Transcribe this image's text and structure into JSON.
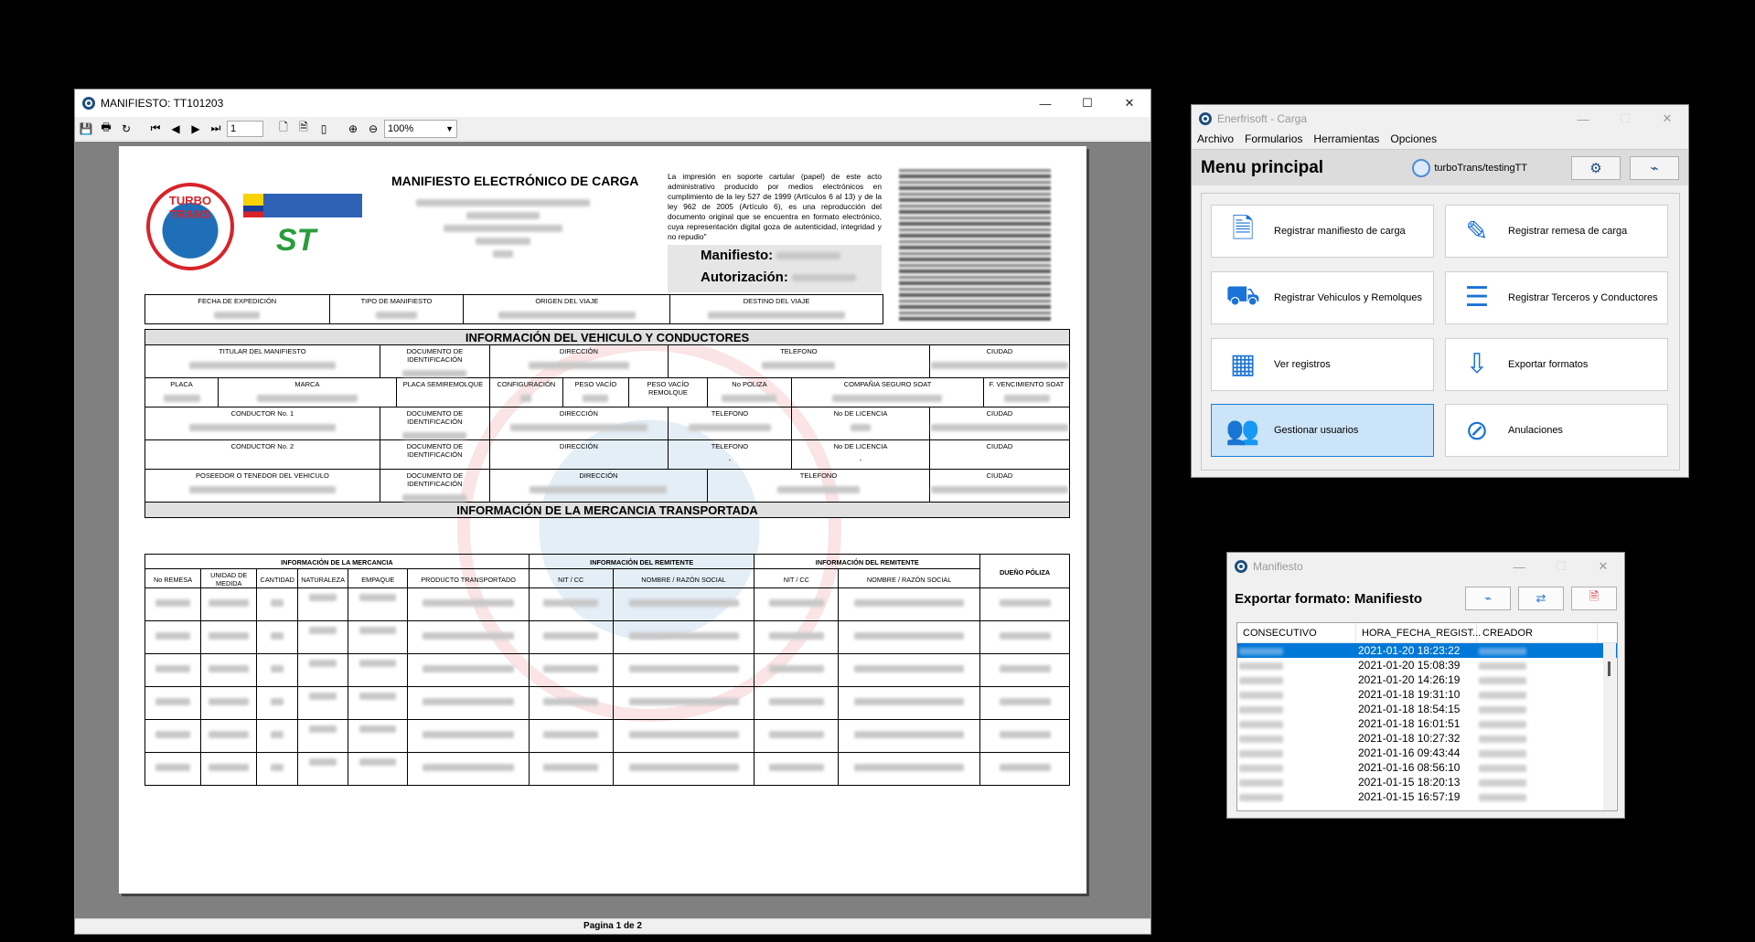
{
  "viewer": {
    "title": "MANIFIESTO: TT101203",
    "page_input": "1",
    "zoom": "100%",
    "status": "Pagina 1 de 2",
    "doc": {
      "title": "MANIFIESTO ELECTRÓNICO DE CARGA",
      "legal": "La impresión en soporte cartular (papel) de este acto administrativo producido por medios electrónicos en cumplimiento de la ley 527 de 1999 (Artículos 6 al 13) y de la ley 962 de 2005 (Artículo 6), es una reproducción del documento original que se encuentra en formato electrónico, cuya representación digital goza de autenticidad, integridad y no repudio\"",
      "manifiesto_label": "Manifiesto:",
      "autorizacion_label": "Autorización:",
      "logo_text": "TURBO TRANS",
      "st_logo": "ST",
      "row1": [
        "FECHA DE EXPEDICIÓN",
        "TIPO DE MANIFIESTO",
        "ORIGEN DEL VIAJE",
        "DESTINO DEL VIAJE"
      ],
      "section_vehiculo": "INFORMACIÓN DEL VEHICULO Y CONDUCTORES",
      "titular": [
        "TITULAR DEL MANIFIESTO",
        "DOCUMENTO DE IDENTIFICACIÓN",
        "DIRECCIÓN",
        "TELEFONO",
        "CIUDAD"
      ],
      "placa": [
        "PLACA",
        "MARCA",
        "PLACA SEMIREMOLQUE",
        "CONFIGURACIÓN",
        "PESO VACÍO",
        "PESO VACÍO REMOLQUE",
        "No POLIZA",
        "COMPAÑIA SEGURO SOAT",
        "F. VENCIMIENTO SOAT"
      ],
      "conductor1": [
        "CONDUCTOR No. 1",
        "DOCUMENTO DE IDENTIFICACIÓN",
        "DIRECCIÓN",
        "TELEFONO",
        "No DE LICENCIA",
        "CIUDAD"
      ],
      "conductor2": [
        "CONDUCTOR No. 2",
        "DOCUMENTO DE IDENTIFICACIÓN",
        "DIRECCIÓN",
        "TELEFONO",
        "No DE LICENCIA",
        "CIUDAD"
      ],
      "conductor2_empty": "-",
      "poseedor": [
        "POSEEDOR O TENEDOR DEL VEHICULO",
        "DOCUMENTO DE IDENTIFICACIÓN",
        "DIRECCIÓN",
        "TELEFONO",
        "CIUDAD"
      ],
      "section_mercancia": "INFORMACIÓN DE LA MERCANCIA TRANSPORTADA",
      "merc_groups": [
        "INFORMACIÓN DE LA MERCANCIA",
        "INFORMACIÓN DEL REMITENTE",
        "INFORMACIÓN DEL REMITENTE",
        "DUEÑO PÓLIZA"
      ],
      "merc_cols": [
        "No REMESA",
        "UNIDAD DE MEDIDA",
        "CANTIDAD",
        "NATURALEZA",
        "EMPAQUE",
        "PRODUCTO TRANSPORTADO",
        "NIT / CC",
        "NOMBRE / RAZÓN SOCIAL",
        "NIT / CC",
        "NOMBRE / RAZÓN SOCIAL"
      ]
    }
  },
  "menu": {
    "title": "Enerfrisoft - Carga",
    "menubar": [
      "Archivo",
      "Formularios",
      "Herramientas",
      "Opciones"
    ],
    "heading": "Menu principal",
    "user": "turboTrans/testingTT",
    "buttons": [
      {
        "label": "Registrar manifiesto de carga",
        "icon": "document-pen-icon"
      },
      {
        "label": "Registrar remesa de carga",
        "icon": "pen-icon"
      },
      {
        "label": "Registrar Vehiculos y Remolques",
        "icon": "truck-icon"
      },
      {
        "label": "Registrar Terceros y Conductores",
        "icon": "contact-list-icon"
      },
      {
        "label": "Ver registros",
        "icon": "table-icon"
      },
      {
        "label": "Exportar formatos",
        "icon": "pdf-export-icon"
      },
      {
        "label": "Gestionar usuarios",
        "icon": "users-icon"
      },
      {
        "label": "Anulaciones",
        "icon": "cancel-document-icon"
      }
    ]
  },
  "export": {
    "title": "Manifiesto",
    "heading": "Exportar formato: Manifiesto",
    "columns": [
      "CONSECUTIVO",
      "HORA_FECHA_REGIST...",
      "CREADOR"
    ],
    "rows": [
      "2021-01-20 18:23:22",
      "2021-01-20 15:08:39",
      "2021-01-20 14:26:19",
      "2021-01-18 19:31:10",
      "2021-01-18 18:54:15",
      "2021-01-18 16:01:51",
      "2021-01-18 10:27:32",
      "2021-01-16 09:43:44",
      "2021-01-16 08:56:10",
      "2021-01-15 18:20:13",
      "2021-01-15 16:57:19"
    ]
  },
  "colors": {
    "accent": "#0078d7",
    "logo_red": "#d8232a",
    "logo_blue": "#1f6fb8"
  }
}
